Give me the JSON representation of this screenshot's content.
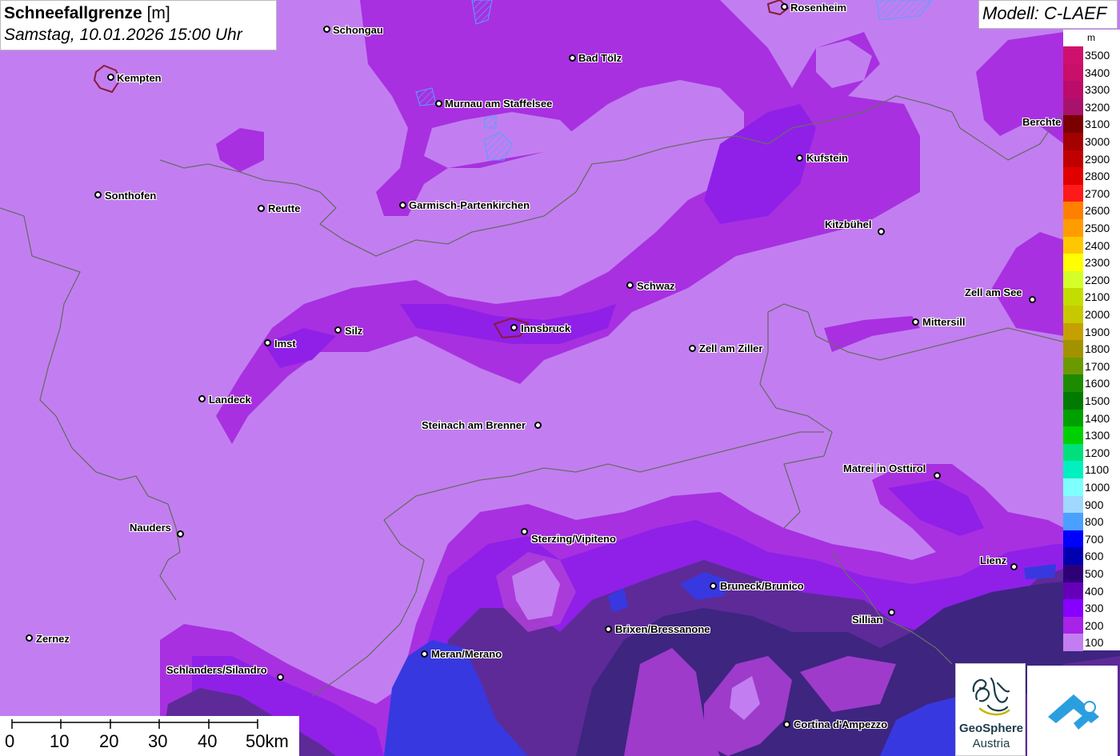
{
  "header": {
    "title": "Schneefallgrenze",
    "unit": "[m]",
    "datetime": "Samstag, 10.01.2026 15:00 Uhr",
    "model": "Modell: C-LAEF"
  },
  "legend": {
    "unit": "m",
    "entries": [
      {
        "value": "3500",
        "color": "#d0106e"
      },
      {
        "value": "3400",
        "color": "#c80f6a"
      },
      {
        "value": "3300",
        "color": "#bb0c6a"
      },
      {
        "value": "3200",
        "color": "#a8126c"
      },
      {
        "value": "3100",
        "color": "#7a0000"
      },
      {
        "value": "3000",
        "color": "#a30000"
      },
      {
        "value": "2900",
        "color": "#c00000"
      },
      {
        "value": "2800",
        "color": "#e00000"
      },
      {
        "value": "2700",
        "color": "#ff1a1a"
      },
      {
        "value": "2600",
        "color": "#ff7f00"
      },
      {
        "value": "2500",
        "color": "#ff9d00"
      },
      {
        "value": "2400",
        "color": "#ffc700"
      },
      {
        "value": "2300",
        "color": "#ffff00"
      },
      {
        "value": "2200",
        "color": "#d4ff29"
      },
      {
        "value": "2100",
        "color": "#c2de00"
      },
      {
        "value": "2000",
        "color": "#c8c800"
      },
      {
        "value": "1900",
        "color": "#c4a000"
      },
      {
        "value": "1800",
        "color": "#a29200"
      },
      {
        "value": "1700",
        "color": "#6b9a00"
      },
      {
        "value": "1600",
        "color": "#1e8a00"
      },
      {
        "value": "1500",
        "color": "#007a00"
      },
      {
        "value": "1400",
        "color": "#00a000"
      },
      {
        "value": "1300",
        "color": "#00d000"
      },
      {
        "value": "1200",
        "color": "#00e07a"
      },
      {
        "value": "1100",
        "color": "#00f0c0"
      },
      {
        "value": "1000",
        "color": "#80ffff"
      },
      {
        "value": "900",
        "color": "#a0d8ff"
      },
      {
        "value": "800",
        "color": "#4aa0ff"
      },
      {
        "value": "700",
        "color": "#0000ff"
      },
      {
        "value": "600",
        "color": "#0000b0"
      },
      {
        "value": "500",
        "color": "#2e0078"
      },
      {
        "value": "400",
        "color": "#6600b8"
      },
      {
        "value": "300",
        "color": "#8800ff"
      },
      {
        "value": "200",
        "color": "#a822e8"
      },
      {
        "value": "100",
        "color": "#c27ef0"
      }
    ]
  },
  "cities": [
    {
      "name": "Rosenheim"
    },
    {
      "name": "Schongau"
    },
    {
      "name": "Kempten"
    },
    {
      "name": "Bad Tölz"
    },
    {
      "name": "Murnau am Staffelsee"
    },
    {
      "name": "Berchte"
    },
    {
      "name": "Kufstein"
    },
    {
      "name": "Sonthofen"
    },
    {
      "name": "Reutte"
    },
    {
      "name": "Garmisch-Partenkirchen"
    },
    {
      "name": "Kitzbühel"
    },
    {
      "name": "Schwaz"
    },
    {
      "name": "Zell am See"
    },
    {
      "name": "Mittersill"
    },
    {
      "name": "Imst"
    },
    {
      "name": "Silz"
    },
    {
      "name": "Innsbruck"
    },
    {
      "name": "Zell am Ziller"
    },
    {
      "name": "Landeck"
    },
    {
      "name": "Steinach am Brenner"
    },
    {
      "name": "Matrei in Osttirol"
    },
    {
      "name": "Nauders"
    },
    {
      "name": "Sterzing/Vipiteno"
    },
    {
      "name": "Lienz"
    },
    {
      "name": "Bruneck/Brunico"
    },
    {
      "name": "Sillian"
    },
    {
      "name": "Brixen/Bressanone"
    },
    {
      "name": "Zernez"
    },
    {
      "name": "Meran/Merano"
    },
    {
      "name": "Schlanders/Silandro"
    },
    {
      "name": "Cortina d'Ampezzo"
    }
  ],
  "scale_bar": {
    "ticks": [
      "0",
      "10",
      "20",
      "30",
      "40",
      "50km"
    ]
  },
  "logo": {
    "line1": "GeoSphere",
    "line2": "Austria"
  }
}
